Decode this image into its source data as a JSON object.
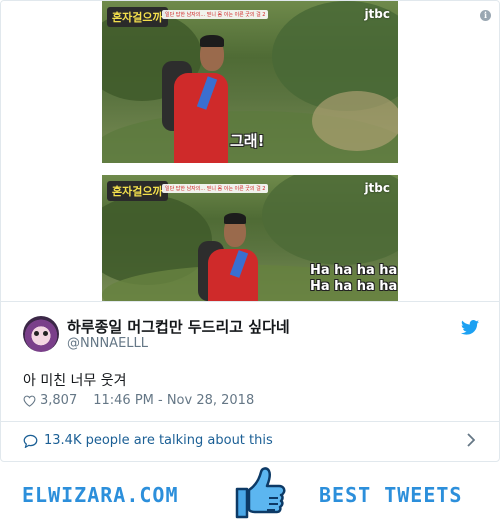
{
  "media": {
    "frame1": {
      "show_logo": "혼자걸으까",
      "caption_strip": "일단 답한 남자의... 믿니 몸 이는 이른 굿의 걸 2",
      "channel": "jtbc",
      "subtitle": "그래!"
    },
    "frame2": {
      "show_logo": "혼자걸으까",
      "caption_strip": "일단 답한 남자의... 믿니 몸 이는 이른 굿의 걸 2",
      "channel": "jtbc",
      "subtitle": "Ha ha ha ha\nHa ha ha ha"
    },
    "info_icon": "i"
  },
  "tweet": {
    "display_name": "하루종일 머그컵만 두드리고 싶다네",
    "handle": "@NNNAELLL",
    "text": "아 미친 너무 웃겨",
    "likes": "3,807",
    "timestamp": "11:46 PM - Nov 28, 2018"
  },
  "talking": {
    "label": "13.4K people are talking about this"
  },
  "footer": {
    "site": "ELWIZARA.COM",
    "tagline": "BEST TWEETS"
  },
  "colors": {
    "twitter_blue": "#1da1f2",
    "link_blue": "#1b5f95",
    "muted": "#657786",
    "brand_blue": "#2c8fdb",
    "jacket_red": "#cf2a2a"
  },
  "icons": [
    "info-icon",
    "twitter-bird-icon",
    "heart-icon",
    "comment-bubble-icon",
    "chevron-right-icon",
    "thumbs-up-icon"
  ]
}
